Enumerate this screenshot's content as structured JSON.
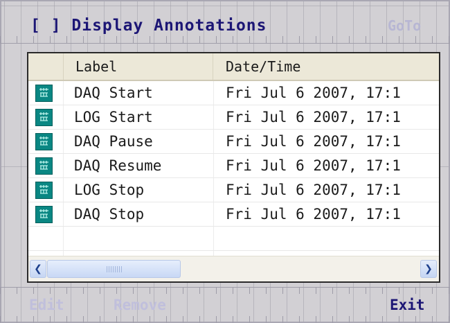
{
  "header": {
    "display_annotations_label": "[ ] Display Annotations",
    "goto_label": "GoTo"
  },
  "table": {
    "columns": [
      "Label",
      "Date/Time"
    ],
    "rows": [
      {
        "label": "DAQ Start",
        "datetime": "Fri Jul 6 2007, 17:1"
      },
      {
        "label": "LOG Start",
        "datetime": "Fri Jul 6 2007, 17:1"
      },
      {
        "label": "DAQ Pause",
        "datetime": "Fri Jul 6 2007, 17:1"
      },
      {
        "label": "DAQ Resume",
        "datetime": "Fri Jul 6 2007, 17:1"
      },
      {
        "label": "LOG Stop",
        "datetime": "Fri Jul 6 2007, 17:1"
      },
      {
        "label": "DAQ Stop",
        "datetime": "Fri Jul 6 2007, 17:1"
      }
    ],
    "row_icon": "annotation-marker-icon"
  },
  "scrollbar": {
    "left_arrow_icon": "scroll-left-arrow-icon",
    "right_arrow_icon": "scroll-right-arrow-icon"
  },
  "footer": {
    "edit_label": "Edit",
    "remove_label": "Remove",
    "exit_label": "Exit"
  },
  "colors": {
    "title_text": "#1c1675",
    "disabled_text": "#c0bfdc",
    "icon_fill": "#0a8783",
    "header_bg": "#ece8d8"
  }
}
